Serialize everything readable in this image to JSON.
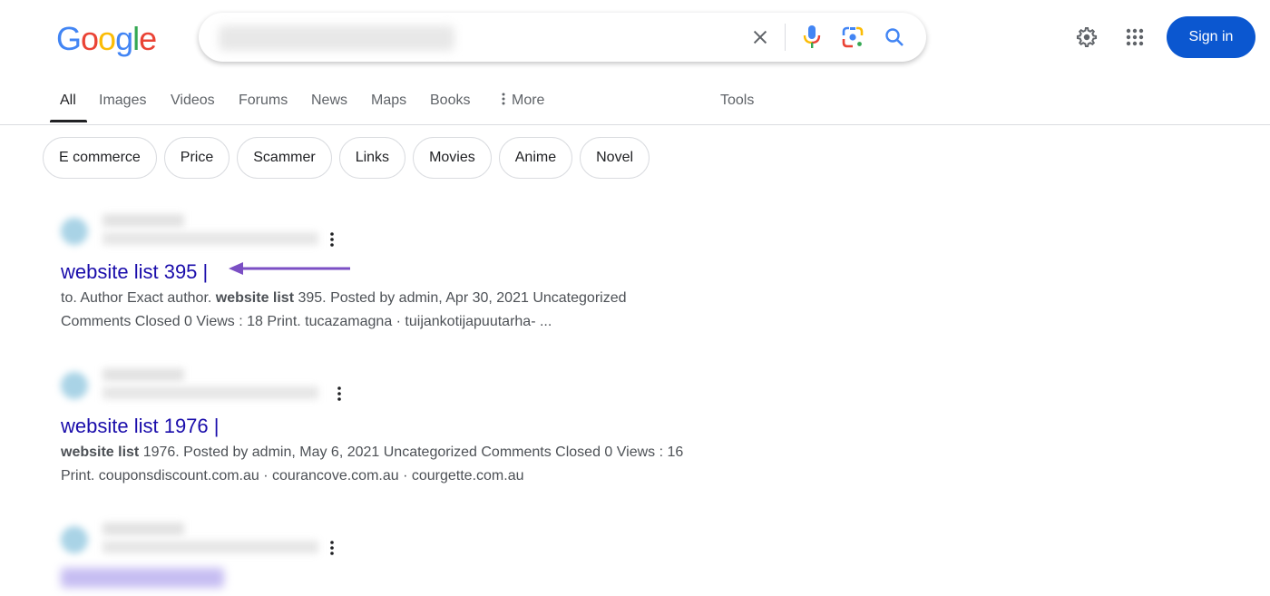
{
  "logo": {
    "letters": [
      "G",
      "o",
      "o",
      "g",
      "l",
      "e"
    ],
    "colors": [
      "#4285f4",
      "#ea4335",
      "#fbbc05",
      "#4285f4",
      "#34a853",
      "#ea4335"
    ]
  },
  "search": {
    "query": "(blurred query)",
    "icons": [
      "close-icon",
      "microphone-icon",
      "google-lens-icon",
      "search-icon"
    ]
  },
  "header": {
    "settings_icon": "gear-icon",
    "apps_icon": "apps-grid-icon",
    "signin_label": "Sign in",
    "signin_color": "#0b57d0"
  },
  "tabs": [
    {
      "label": "All",
      "active": true
    },
    {
      "label": "Images"
    },
    {
      "label": "Videos"
    },
    {
      "label": "Forums"
    },
    {
      "label": "News"
    },
    {
      "label": "Maps"
    },
    {
      "label": "Books"
    },
    {
      "label": "More",
      "icon": "vertical-dots-icon"
    }
  ],
  "tools_label": "Tools",
  "chips": [
    "E commerce",
    "Price",
    "Scammer",
    "Links",
    "Movies",
    "Anime",
    "Novel"
  ],
  "results": [
    {
      "title": "website list 395 |",
      "snippet_line1_pre": "to. Author Exact author. ",
      "snippet_line1_bold": "website list",
      "snippet_line1_post": " 395. Posted by admin, Apr 30, 2021 Uncategorized",
      "snippet_line2": "Comments Closed 0 Views : 18 Print. tucazamagna · tuijankotijapuutarha- ...",
      "annotated": true
    },
    {
      "title": "website list 1976 |",
      "snippet_line1_pre": "",
      "snippet_line1_bold": "website list",
      "snippet_line1_post": " 1976. Posted by admin, May 6, 2021 Uncategorized Comments Closed 0 Views : 16",
      "snippet_line2": "Print. couponsdiscount.com.au · courancove.com.au · courgette.com.au"
    },
    {
      "title": "(blurred)",
      "blurred": true
    }
  ],
  "annotation": {
    "type": "arrow",
    "color": "#7b4fc4",
    "points_to": "website list 395 |"
  }
}
